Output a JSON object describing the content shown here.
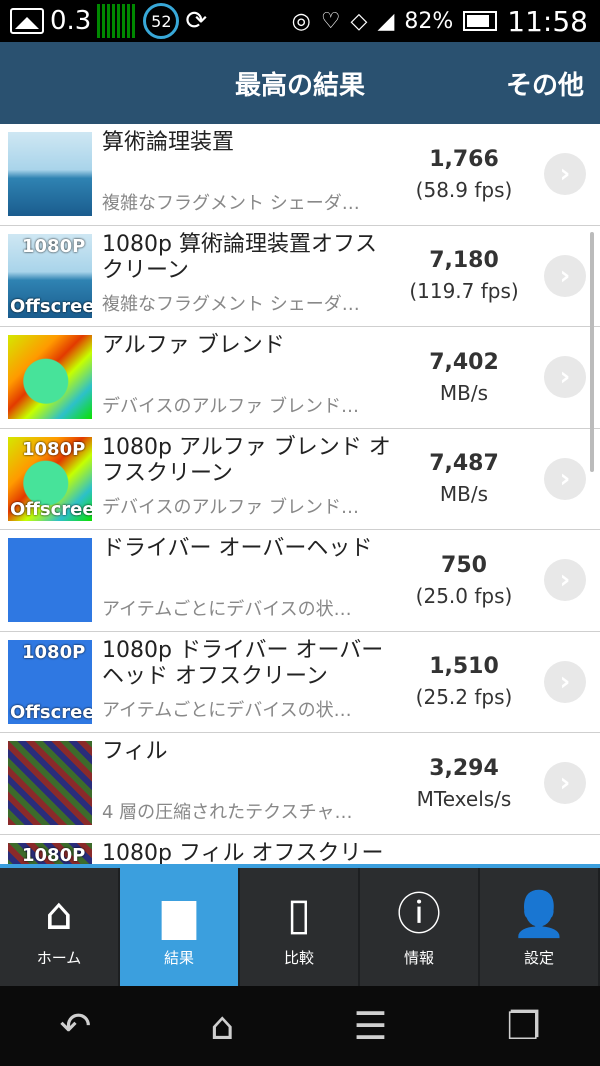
{
  "status": {
    "left_value": "0.3",
    "circle_value": "52",
    "battery": "82%",
    "time": "11:58"
  },
  "header": {
    "title": "最高の結果",
    "more": "その他"
  },
  "results": [
    {
      "name": "算術論理装置",
      "desc": "複雑なフラグメント シェーダ…",
      "value": "1,766",
      "unit": "(58.9 fps)",
      "thumb": "sky",
      "offscreen": false
    },
    {
      "name": "1080p 算術論理装置オフスクリーン",
      "desc": "複雑なフラグメント シェーダ…",
      "value": "7,180",
      "unit": "(119.7 fps)",
      "thumb": "sky",
      "offscreen": true
    },
    {
      "name": "アルファ ブレンド",
      "desc": "デバイスのアルファ ブレンド…",
      "value": "7,402",
      "unit": "MB/s",
      "thumb": "alpha",
      "offscreen": false
    },
    {
      "name": "1080p アルファ ブレンド オフスクリーン",
      "desc": "デバイスのアルファ ブレンド…",
      "value": "7,487",
      "unit": "MB/s",
      "thumb": "alpha",
      "offscreen": true
    },
    {
      "name": "ドライバー オーバーヘッド",
      "desc": "アイテムごとにデバイスの状…",
      "value": "750",
      "unit": "(25.0 fps)",
      "thumb": "driver",
      "offscreen": false
    },
    {
      "name": "1080p ドライバー オーバーヘッド オフスクリーン",
      "desc": "アイテムごとにデバイスの状…",
      "value": "1,510",
      "unit": "(25.2 fps)",
      "thumb": "driver",
      "offscreen": true
    },
    {
      "name": "フィル",
      "desc": "4 層の圧縮されたテクスチャ…",
      "value": "3,294",
      "unit": "MTexels/s",
      "thumb": "fill",
      "offscreen": false
    },
    {
      "name": "1080p フィル オフスクリー",
      "desc": "",
      "value": "",
      "unit": "",
      "thumb": "fill",
      "offscreen": true
    }
  ],
  "badges": {
    "top": "1080P",
    "bottom": "Offscreen"
  },
  "tabs": [
    {
      "label": "ホーム",
      "icon": "home-icon",
      "glyph": "⌂",
      "active": false
    },
    {
      "label": "結果",
      "icon": "bar-chart-icon",
      "glyph": "▆",
      "active": true
    },
    {
      "label": "比較",
      "icon": "phone-icon",
      "glyph": "▯",
      "active": false
    },
    {
      "label": "情報",
      "icon": "info-icon",
      "glyph": "ⓘ",
      "active": false
    },
    {
      "label": "設定",
      "icon": "user-icon",
      "glyph": "👤",
      "active": false
    }
  ],
  "colors": {
    "header": "#2a5170",
    "active_tab": "#3b9fde"
  }
}
